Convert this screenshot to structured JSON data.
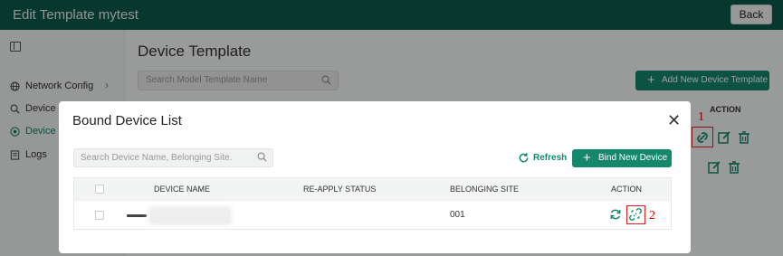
{
  "app": {
    "title": "Edit Template mytest",
    "back_label": "Back"
  },
  "sidebar": {
    "items": [
      {
        "label": "Network Config",
        "icon": "globe-icon"
      },
      {
        "label": "Device Co",
        "icon": "search-icon"
      },
      {
        "label": "Device Te",
        "icon": "target-icon",
        "active": true
      },
      {
        "label": "Logs",
        "icon": "document-icon"
      }
    ]
  },
  "main": {
    "title": "Device Template",
    "search_placeholder": "Search Model Template Name",
    "add_button": "Add New Device Template",
    "action_header": "ACTION"
  },
  "markers": {
    "first": "1",
    "second": "2"
  },
  "modal": {
    "title": "Bound Device List",
    "search_placeholder": "Search Device Name, Belonging Site.",
    "refresh_label": "Refresh",
    "bind_button": "Bind New Device",
    "columns": [
      "DEVICE NAME",
      "RE-APPLY STATUS",
      "BELONGING SITE",
      "ACTION"
    ],
    "rows": [
      {
        "device_name": "",
        "reapply_status": "",
        "belonging_site": "001"
      }
    ]
  },
  "colors": {
    "primary": "#15876d",
    "topbar": "#0c5a4a",
    "highlight": "#e02020"
  }
}
